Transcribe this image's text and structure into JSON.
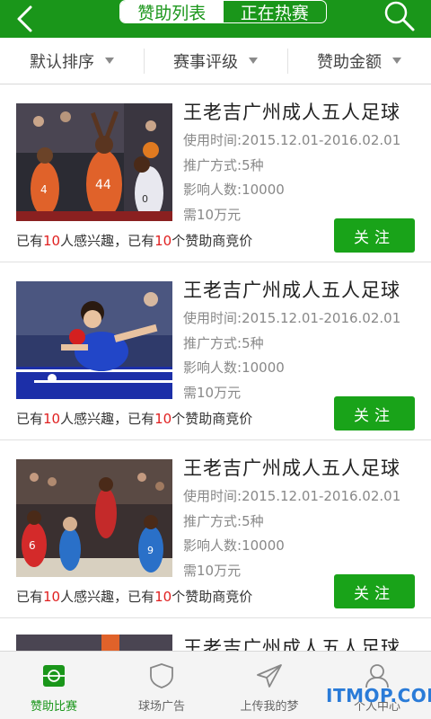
{
  "header": {
    "tabs": [
      {
        "label": "赞助列表",
        "active": true
      },
      {
        "label": "正在热赛",
        "active": false
      }
    ]
  },
  "filters": [
    {
      "label": "默认排序"
    },
    {
      "label": "赛事评级"
    },
    {
      "label": "赞助金额"
    }
  ],
  "cards": [
    {
      "image": "basketball-players",
      "title": "王老吉广州成人五人足球",
      "time_label": "使用时间:",
      "time_value": "2015.12.01-2016.02.01",
      "method_label": "推广方式:",
      "method_value": "5种",
      "audience_label": "影响人数:",
      "audience_value": "10000",
      "price": "需10万元",
      "interest_prefix": "已有",
      "interest_count": "10",
      "interest_mid": "人感兴趣，已有",
      "sponsor_count": "10",
      "interest_suffix": "个赞助商竞价",
      "follow_label": "关注"
    },
    {
      "image": "table-tennis-player",
      "title": "王老吉广州成人五人足球",
      "time_label": "使用时间:",
      "time_value": "2015.12.01-2016.02.01",
      "method_label": "推广方式:",
      "method_value": "5种",
      "audience_label": "影响人数:",
      "audience_value": "10000",
      "price": "需10万元",
      "interest_prefix": "已有",
      "interest_count": "10",
      "interest_mid": "人感兴趣，已有",
      "sponsor_count": "10",
      "interest_suffix": "个赞助商竞价",
      "follow_label": "关注"
    },
    {
      "image": "basketball-game",
      "title": "王老吉广州成人五人足球",
      "time_label": "使用时间:",
      "time_value": "2015.12.01-2016.02.01",
      "method_label": "推广方式:",
      "method_value": "5种",
      "audience_label": "影响人数:",
      "audience_value": "10000",
      "price": "需10万元",
      "interest_prefix": "已有",
      "interest_count": "10",
      "interest_mid": "人感兴趣，已有",
      "sponsor_count": "10",
      "interest_suffix": "个赞助商竞价",
      "follow_label": "关注"
    },
    {
      "image": "basketball-players",
      "title": "王老吉广州成人五人足球"
    }
  ],
  "tabbar": [
    {
      "label": "赞助比赛",
      "icon": "sponsor-match-icon",
      "active": true
    },
    {
      "label": "球场广告",
      "icon": "shield-icon",
      "active": false
    },
    {
      "label": "上传我的梦",
      "icon": "paper-plane-icon",
      "active": false
    },
    {
      "label": "个人中心",
      "icon": "person-icon",
      "active": false
    }
  ],
  "watermark": "ITMOP.COM",
  "colors": {
    "brand_green": "#1a961a",
    "button_green": "#19a319",
    "highlight_red": "#e02020"
  }
}
